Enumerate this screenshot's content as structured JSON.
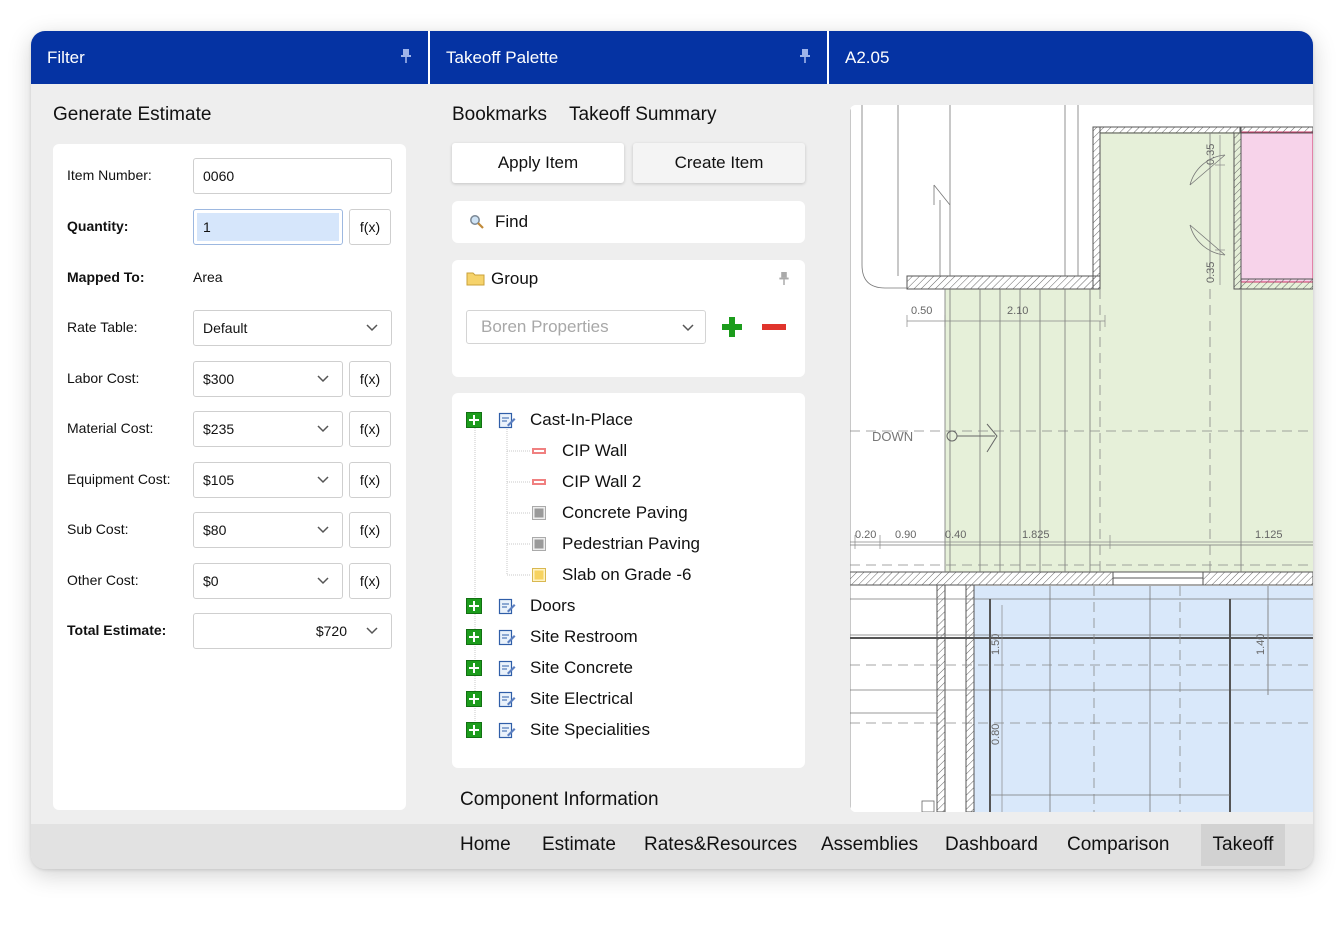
{
  "titlebar": {
    "filter": "Filter",
    "palette": "Takeoff Palette",
    "sheet": "A2.05"
  },
  "estimate": {
    "title": "Generate Estimate",
    "item_number_label": "Item Number:",
    "item_number": "0060",
    "quantity_label": "Quantity:",
    "quantity": "1",
    "mapped_to_label": "Mapped To:",
    "mapped_to": "Area",
    "rate_table_label": "Rate Table:",
    "rate_table": "Default",
    "labor_label": "Labor Cost:",
    "labor": "$300",
    "material_label": "Material Cost:",
    "material": "$235",
    "equipment_label": "Equipment Cost:",
    "equipment": "$105",
    "sub_label": "Sub Cost:",
    "sub": "$80",
    "other_label": "Other Cost:",
    "other": "$0",
    "total_label": "Total Estimate:",
    "total": "$720",
    "fx": "f(x)"
  },
  "palette": {
    "tab_bookmarks": "Bookmarks",
    "tab_summary": "Takeoff Summary",
    "apply": "Apply Item",
    "create": "Create Item",
    "find_placeholder": "Find",
    "group_label": "Group",
    "group_select": "Boren Properties",
    "component_info": "Component Information"
  },
  "tree": {
    "cast_in_place": "Cast-In-Place",
    "cip_wall": "CIP Wall",
    "cip_wall_2": "CIP Wall 2",
    "concrete_paving": "Concrete Paving",
    "pedestrian_paving": "Pedestrian Paving",
    "slab_on_grade": "Slab on Grade -6",
    "doors": "Doors",
    "site_restroom": "Site Restroom",
    "site_concrete": "Site Concrete",
    "site_electrical": "Site Electrical",
    "site_specialities": "Site Specialities"
  },
  "drawing": {
    "down": "DOWN",
    "d035a": "0.35",
    "d035b": "0.35",
    "d050": "0.50",
    "d210": "2.10",
    "d020": "0.20",
    "d090": "0.90",
    "d040": "0.40",
    "d1825": "1.825",
    "d1125": "1.125",
    "d150": "1.50",
    "d080": "0.80",
    "d140": "1.40"
  },
  "nav": {
    "home": "Home",
    "estimate": "Estimate",
    "rates": "Rates&Resources",
    "assemblies": "Assemblies",
    "dashboard": "Dashboard",
    "comparison": "Comparison",
    "takeoff": "Takeoff"
  },
  "colors": {
    "titlebar": "#0533a3",
    "area_green": "#e6f0d9",
    "area_blue": "#d9e8fa",
    "area_pink": "#f7d3ea",
    "add_green": "#1c9c1c",
    "remove_red": "#e0342c"
  }
}
